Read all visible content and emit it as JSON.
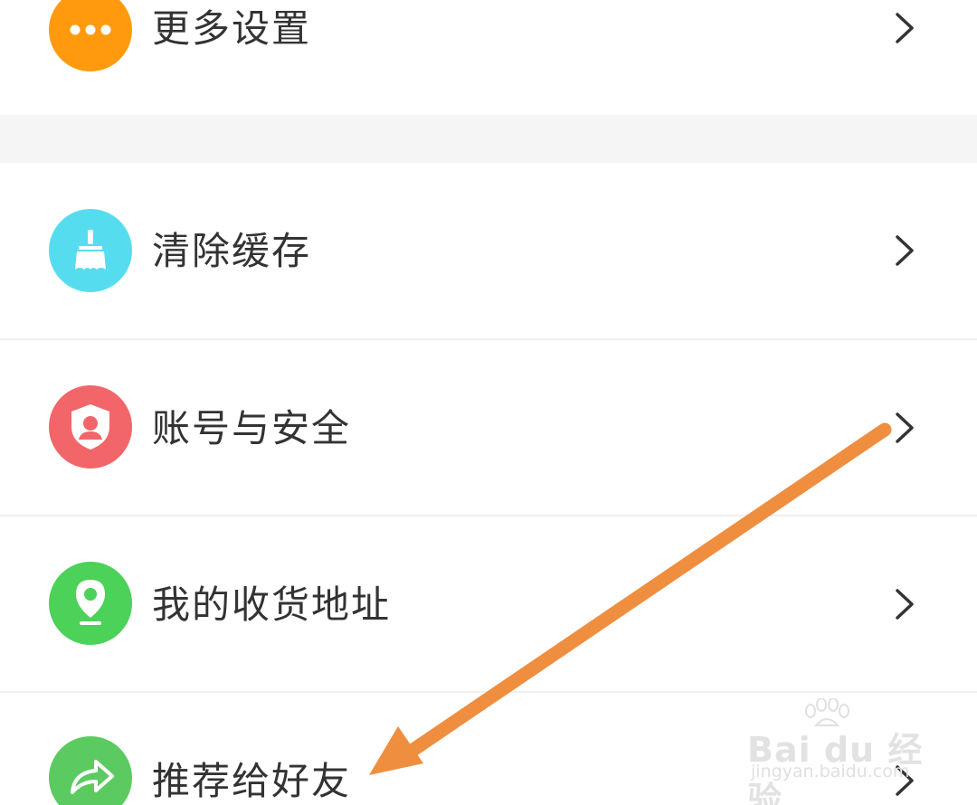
{
  "menu": {
    "items": [
      {
        "label": "更多设置",
        "icon": "more-dots-icon",
        "color": "#FF9A0E"
      },
      {
        "label": "清除缓存",
        "icon": "broom-icon",
        "color": "#55DDEF"
      },
      {
        "label": "账号与安全",
        "icon": "shield-user-icon",
        "color": "#F26669"
      },
      {
        "label": "我的收货地址",
        "icon": "location-pin-icon",
        "color": "#4CD159"
      },
      {
        "label": "推荐给好友",
        "icon": "share-arrow-icon",
        "color": "#5BCB61"
      }
    ]
  },
  "watermark": {
    "brand": "Bai  du 经验",
    "url": "jingyan.baidu.com"
  },
  "annotation": {
    "arrow_color": "#EF8E3F"
  }
}
